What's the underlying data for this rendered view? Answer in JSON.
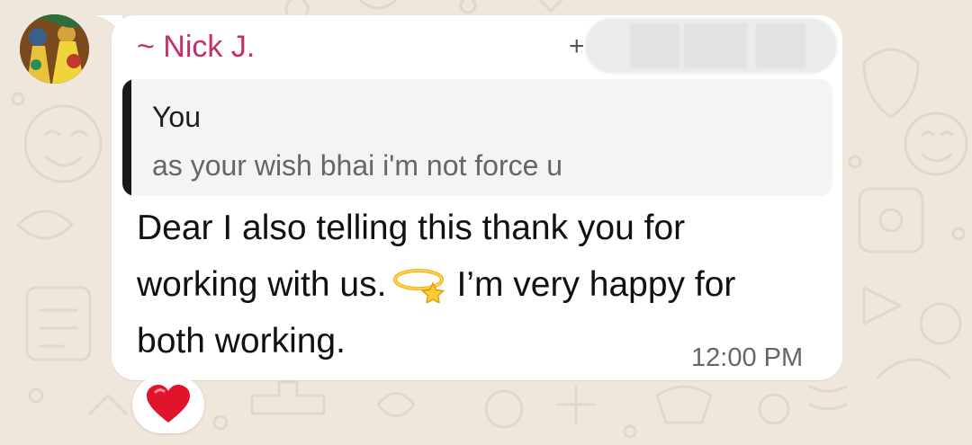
{
  "chat": {
    "sender_name": "~ Nick J.",
    "sender_phone_prefix": "+",
    "quoted": {
      "author": "You",
      "text": "as your wish bhai i'm not force u"
    },
    "message_lines": [
      "Dear I also telling this thank you for",
      "working with us.",
      "I’m very happy for",
      "both working."
    ],
    "inline_emoji_icon": "dizzy-star-icon",
    "timestamp": "12:00 PM",
    "reaction_icon": "red-heart-icon"
  },
  "colors": {
    "sender_name": "#c42f6e",
    "wallpaper": "#efe7dc",
    "bubble": "#ffffff",
    "quote_bar": "#1a1a1a",
    "heart": "#e0142b"
  }
}
